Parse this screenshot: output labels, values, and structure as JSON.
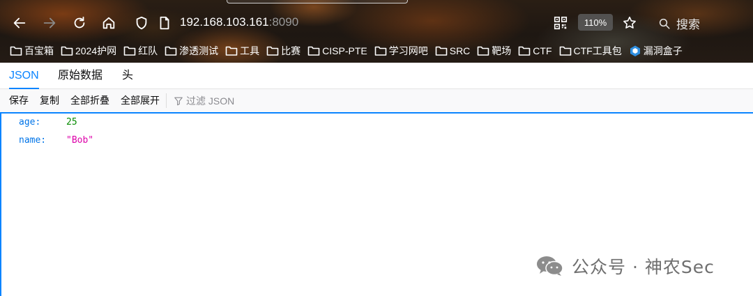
{
  "browser": {
    "url_host": "192.168.103.161",
    "url_port": ":8090",
    "zoom": "110%",
    "search_label": "搜索",
    "icons": [
      "back-icon",
      "forward-icon",
      "reload-icon",
      "home-icon",
      "shield-icon",
      "page-icon",
      "qr-code-icon",
      "star-icon",
      "search-icon"
    ]
  },
  "bookmarks": [
    {
      "label": "百宝箱"
    },
    {
      "label": "2024护网"
    },
    {
      "label": "红队"
    },
    {
      "label": "渗透测试"
    },
    {
      "label": "工具"
    },
    {
      "label": "比赛"
    },
    {
      "label": "CISP-PTE"
    },
    {
      "label": "学习网吧"
    },
    {
      "label": "SRC"
    },
    {
      "label": "靶场"
    },
    {
      "label": "CTF"
    },
    {
      "label": "CTF工具包"
    },
    {
      "label": "漏洞盒子"
    }
  ],
  "viewer": {
    "tabs": [
      "JSON",
      "原始数据",
      "头"
    ],
    "active_tab": "JSON",
    "toolbar": {
      "save": "保存",
      "copy": "复制",
      "collapse_all": "全部折叠",
      "expand_all": "全部展开",
      "filter_placeholder": "过滤 JSON"
    },
    "rows": [
      {
        "key": "age:",
        "value": "25"
      },
      {
        "key": "name:",
        "value": "\"Bob\""
      }
    ]
  },
  "watermark": {
    "text": "公众号 · 神农Sec"
  },
  "colors": {
    "accent": "#0a84ff",
    "json_key": "#0074e8",
    "json_number": "#058b00",
    "json_string": "#dd00a9"
  }
}
